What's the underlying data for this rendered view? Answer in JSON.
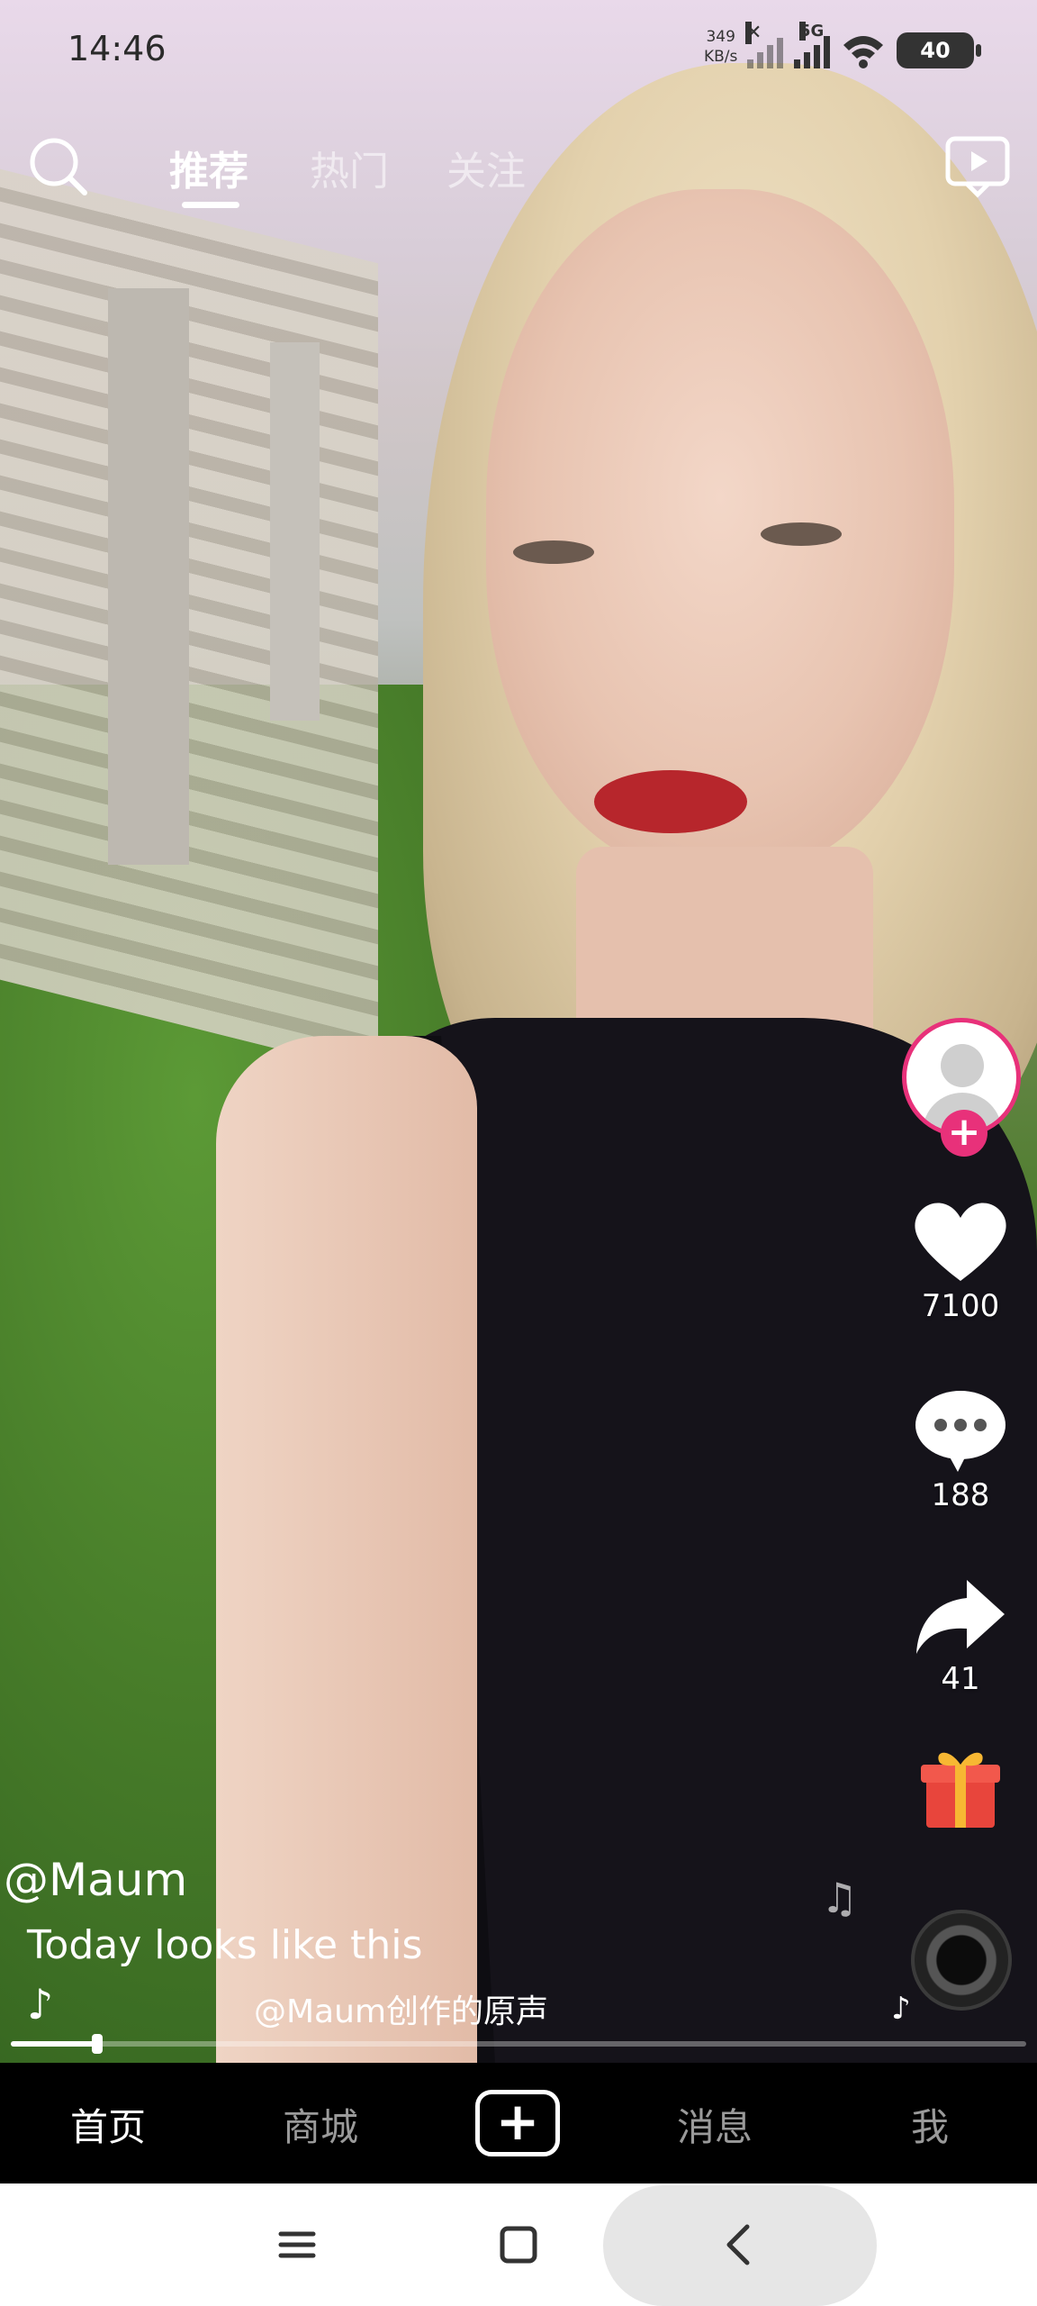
{
  "status_bar": {
    "time": "14:46",
    "speed_value": "349",
    "speed_unit": "KB/s",
    "network": "5G",
    "battery": "40",
    "icons": [
      "no-signal-icon",
      "signal-icon",
      "wifi-icon",
      "battery-icon"
    ]
  },
  "top_nav": {
    "tabs": [
      {
        "label": "推荐",
        "active": true
      },
      {
        "label": "热门",
        "active": false
      },
      {
        "label": "关注",
        "active": false
      }
    ],
    "icons": [
      "search-icon",
      "live-tv-icon"
    ]
  },
  "side_rail": {
    "likes": "7100",
    "comments": "188",
    "shares": "41",
    "icons": [
      "avatar",
      "follow-plus-icon",
      "heart-icon",
      "comment-icon",
      "share-icon",
      "gift-icon",
      "music-disc-icon"
    ]
  },
  "caption": {
    "author": "@Maum",
    "description": "Today looks like this",
    "sound": "@Maum创作的原声",
    "note_icon": "♪"
  },
  "progress": {
    "value": 0.085
  },
  "bottom_nav": {
    "home": "首页",
    "mall": "商城",
    "create": "+",
    "messages": "消息",
    "me": "我"
  },
  "colors": {
    "accent_pink": "#e8317a",
    "nav_bg": "#000000"
  }
}
